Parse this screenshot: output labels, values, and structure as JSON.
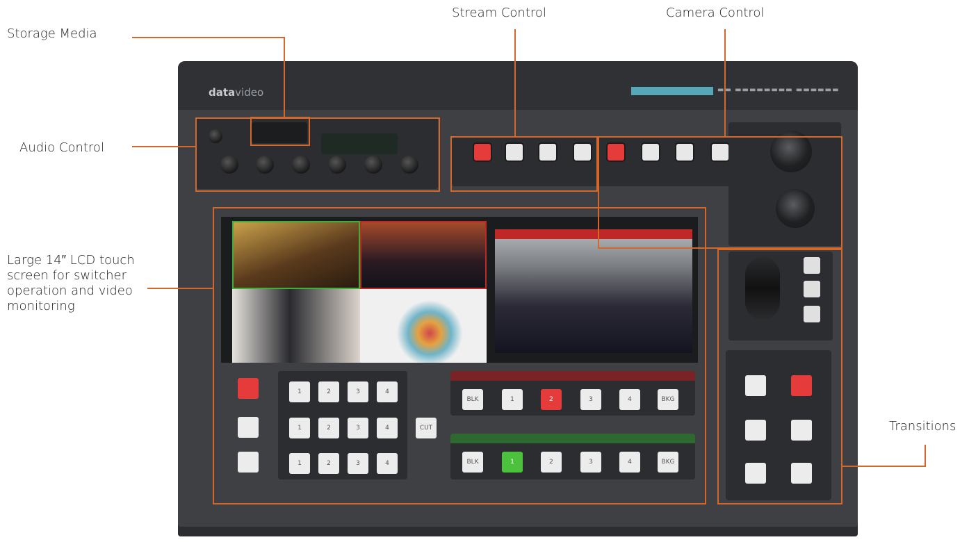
{
  "labels": {
    "storage_media": "Storage Media",
    "stream_control": "Stream Control",
    "camera_control": "Camera Control",
    "audio_control": "Audio Control",
    "lcd_screen": "Large 14″ LCD touch screen for switcher operation and video monitoring",
    "transitions": "Transitions"
  },
  "device": {
    "brand_prefix": "data",
    "brand_suffix": "video"
  },
  "colors": {
    "callout_line": "#d4682a",
    "device_body": "#3e4044",
    "program_red": "#e53b3b",
    "preview_green": "#4cc13d"
  },
  "switcher": {
    "program_row": [
      "BLK",
      "1",
      "2",
      "3",
      "4",
      "BKG"
    ],
    "preview_row": [
      "BLK",
      "1",
      "2",
      "3",
      "4",
      "BKG"
    ],
    "program_active_index": 2,
    "preview_active_index": 1,
    "cut_label": "CUT"
  }
}
